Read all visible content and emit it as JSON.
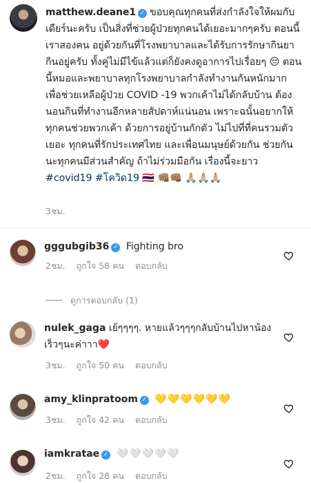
{
  "post": {
    "username": "matthew.deane1",
    "caption_text": "ขอบคุณทุกคนที่ส่งกำลังใจให้ผมกับเดียร์นะครับ เป็นสิ่งที่ช่วยผู้ป่วยทุกคนได้เยอะมากๆครับ ตอนนี้เราสองคน อยู่ด้วยกันที่โรงพยาบาลและได้รับการรักษากินยากินอยู่ครับ ทั้งคู่ไม่มีไข้แล้วแต่ก็ยังคงดูอาการไปเรื่อยๆ 😔 ตอนนี้หมอและพยาบาลทุกโรงพยาบาลกำลังทำงานกันหนักมาก เพื่อช่วยเหลือผู้ป่วย COVID -19 พวกเค้าไม่ได้กลับบ้าน ต้องนอนกินที่ทำงานอีกหลายสัปดาห์แน่นอน เพราะฉนั้นอยากให้ทุกคนช่วยพวกเค้า ด้วยการอยู่บ้านกักตัว ไม่ไปที่ที่คนรวมตัวเยอะ ทุกคนที่รักประเทศไทย และเพื่อนมนุษย์ด้วยกัน ช่วยกันนะทุกคนมีส่วนสำคัญ ถ้าไม่ร่วมมือกัน เรื่องนี้จะยาว",
    "hashtags": "#covid19 #โควิด19",
    "caption_emojis": "🇹🇭 👊🏽👊🏽 🙏🏼🙏🏼🙏🏼",
    "time": "3ชม."
  },
  "comments": [
    {
      "username": "gggubgib36",
      "text": "Fighting bro",
      "time": "2ชม.",
      "likes": "ถูกใจ 58 คน",
      "reply": "ตอบกลับ"
    },
    {
      "username": "nulek_gaga",
      "text": "เย้ๆๆๆๆ. หายแล้วๆๆๆกลับบ้านไปหาน้องเร็วๆนะค่าาา❤️",
      "time": "3ชม.",
      "likes": "ถูกใจ 50 คน",
      "reply": "ตอบกลับ"
    },
    {
      "username": "amy_klinpratoom",
      "text": "💛💛💛💛💛💛",
      "time": "3ชม.",
      "likes": "ถูกใจ 42 คน",
      "reply": "ตอบกลับ"
    },
    {
      "username": "iamkratae",
      "text": "🤍🤍🤍🤍🤍",
      "time": "2ชม.",
      "likes": "ถูกใจ 28 คน",
      "reply": "ตอบกลับ"
    }
  ],
  "view_replies": "ดูการตอบกลับ (1)",
  "icons": {
    "verified": "verified-badge-icon",
    "like": "heart-icon"
  },
  "colors": {
    "verified": "#3897f0",
    "hashtag": "#003569",
    "meta": "#8e8e8e"
  }
}
